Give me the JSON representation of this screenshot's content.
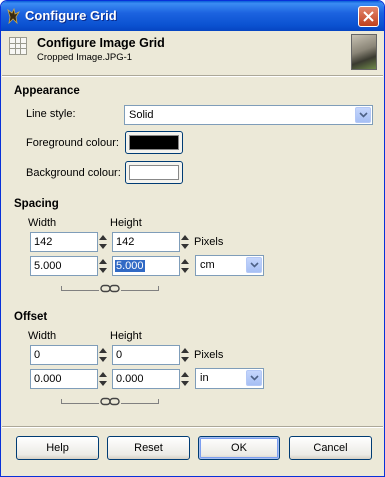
{
  "window": {
    "title": "Configure Grid",
    "header_title": "Configure Image Grid",
    "header_subtitle": "Cropped Image.JPG-1"
  },
  "appearance": {
    "section_title": "Appearance",
    "line_style_label": "Line style:",
    "line_style_value": "Solid",
    "foreground_label": "Foreground colour:",
    "foreground_color": "#000000",
    "background_label": "Background colour:",
    "background_color": "#ffffff"
  },
  "spacing": {
    "section_title": "Spacing",
    "width_label": "Width",
    "height_label": "Height",
    "width_px": "142",
    "height_px": "142",
    "pixels_label": "Pixels",
    "width_unit_value": "5.000",
    "height_unit_value": "5.000",
    "unit": "cm"
  },
  "offset": {
    "section_title": "Offset",
    "width_label": "Width",
    "height_label": "Height",
    "width_px": "0",
    "height_px": "0",
    "pixels_label": "Pixels",
    "width_unit_value": "0.000",
    "height_unit_value": "0.000",
    "unit": "in"
  },
  "buttons": {
    "help": "Help",
    "reset": "Reset",
    "ok": "OK",
    "cancel": "Cancel"
  },
  "colors": {
    "titlebar": "#0b52d1",
    "dialog_bg": "#ece9d8",
    "selection": "#316ac5"
  },
  "icons": {
    "app": "gimp-app-icon",
    "header": "grid-icon",
    "close": "close-icon",
    "link": "chain-link-icon"
  }
}
